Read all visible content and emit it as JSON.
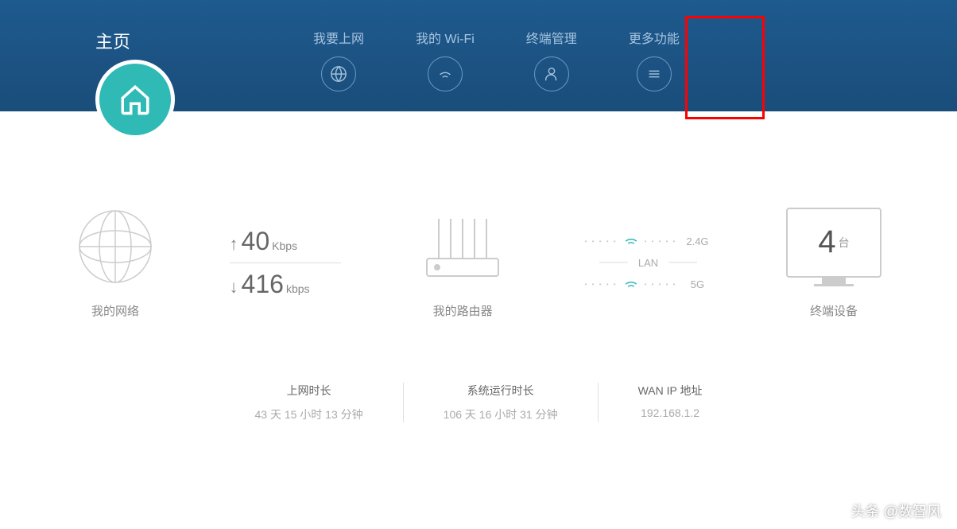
{
  "nav": {
    "home": "主页",
    "internet": "我要上网",
    "wifi": "我的 Wi-Fi",
    "devices": "终端管理",
    "more": "更多功能"
  },
  "cards": {
    "network": {
      "label": "我的网络"
    },
    "speed": {
      "up_value": "40",
      "up_unit": "Kbps",
      "down_value": "416",
      "down_unit": "kbps"
    },
    "router": {
      "label": "我的路由器"
    },
    "bands": {
      "g24": "2.4G",
      "lan": "LAN",
      "g5": "5G"
    },
    "device": {
      "count": "4",
      "unit": "台",
      "label": "终端设备"
    }
  },
  "stats": {
    "uptime": {
      "title": "上网时长",
      "value": "43 天 15 小时 13 分钟"
    },
    "runtime": {
      "title": "系统运行时长",
      "value": "106 天 16 小时 31 分钟"
    },
    "wanip": {
      "title": "WAN IP 地址",
      "value": "192.168.1.2"
    }
  },
  "watermark": "头条 @数智风"
}
